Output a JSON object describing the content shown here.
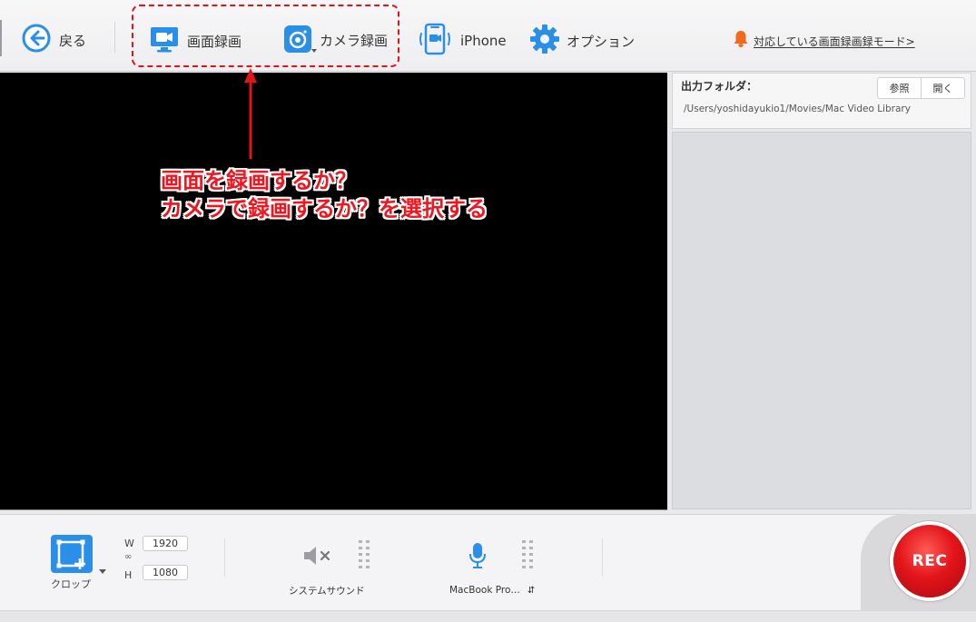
{
  "toolbar": {
    "back_label": "戻る",
    "screen_record_label": "画面録画",
    "camera_record_label": "カメラ録画",
    "iphone_label": "iPhone",
    "options_label": "オプション",
    "notice_label": "対応している画面録画録モード>"
  },
  "annotation": {
    "line1": "画面を録画するか？",
    "line2": "カメラで録画するか？を選択する"
  },
  "output": {
    "label": "出力フォルダ：",
    "browse_label": "参照",
    "open_label": "開く",
    "path": "/Users/yoshidayukio1/Movies/Mac Video Library"
  },
  "bottom": {
    "crop_label": "クロップ",
    "width_letter": "W",
    "height_letter": "H",
    "width_value": "1920",
    "height_value": "1080",
    "system_sound_label": "システムサウンド",
    "mic_label": "MacBook Pro…",
    "rec_label": "REC"
  },
  "colors": {
    "accent_blue": "#2a8fe8",
    "annotation_red": "#f01620",
    "rec_red": "#e2141a",
    "notice_orange": "#f26b1d"
  },
  "icons": {
    "back": "arrow-left-circle-icon",
    "screen": "monitor-camera-icon",
    "camera": "camera-icon",
    "iphone": "phone-icon",
    "options": "gear-icon",
    "notice": "bell-icon",
    "crop": "crop-icon",
    "system_sound": "speaker-muted-icon",
    "mic": "microphone-icon"
  }
}
